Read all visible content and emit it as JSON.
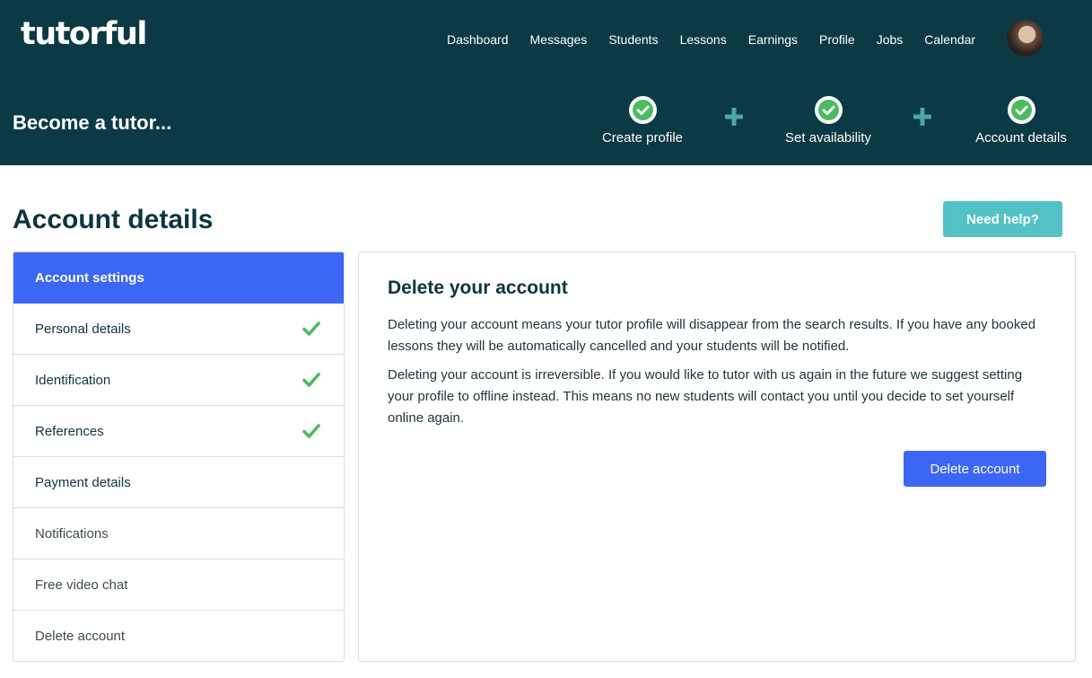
{
  "header": {
    "logo": "tutorful",
    "nav": [
      "Dashboard",
      "Messages",
      "Students",
      "Lessons",
      "Earnings",
      "Profile",
      "Jobs",
      "Calendar"
    ],
    "avatar_icon": "user-avatar"
  },
  "onboarding": {
    "title": "Become a tutor...",
    "steps": [
      {
        "label": "Create profile",
        "complete": true
      },
      {
        "label": "Set availability",
        "complete": true
      },
      {
        "label": "Account details",
        "complete": true
      }
    ]
  },
  "page": {
    "title": "Account details",
    "help_button": "Need help?"
  },
  "sidebar": {
    "items": [
      {
        "label": "Account settings",
        "active": true,
        "complete": false
      },
      {
        "label": "Personal details",
        "active": false,
        "complete": true
      },
      {
        "label": "Identification",
        "active": false,
        "complete": true
      },
      {
        "label": "References",
        "active": false,
        "complete": true
      },
      {
        "label": "Payment details",
        "active": false,
        "complete": false
      },
      {
        "label": "Notifications",
        "active": false,
        "complete": false
      },
      {
        "label": "Free video chat",
        "active": false,
        "complete": false
      },
      {
        "label": "Delete account",
        "active": false,
        "complete": false
      }
    ]
  },
  "panel": {
    "title": "Delete your account",
    "paragraph1": "Deleting your account means your tutor profile will disappear from the search results. If you have any booked lessons they will be automatically cancelled and your students will be notified.",
    "paragraph2": "Deleting your account is irreversible. If you would like to tutor with us again in the future we suggest setting your profile to offline instead. This means no new students will contact you until you decide to set yourself online again.",
    "delete_button": "Delete account"
  },
  "colors": {
    "header_bg": "#0b3a44",
    "primary_blue": "#3c66f4",
    "help_teal": "#52c2c4",
    "check_green": "#4dbb5f"
  }
}
